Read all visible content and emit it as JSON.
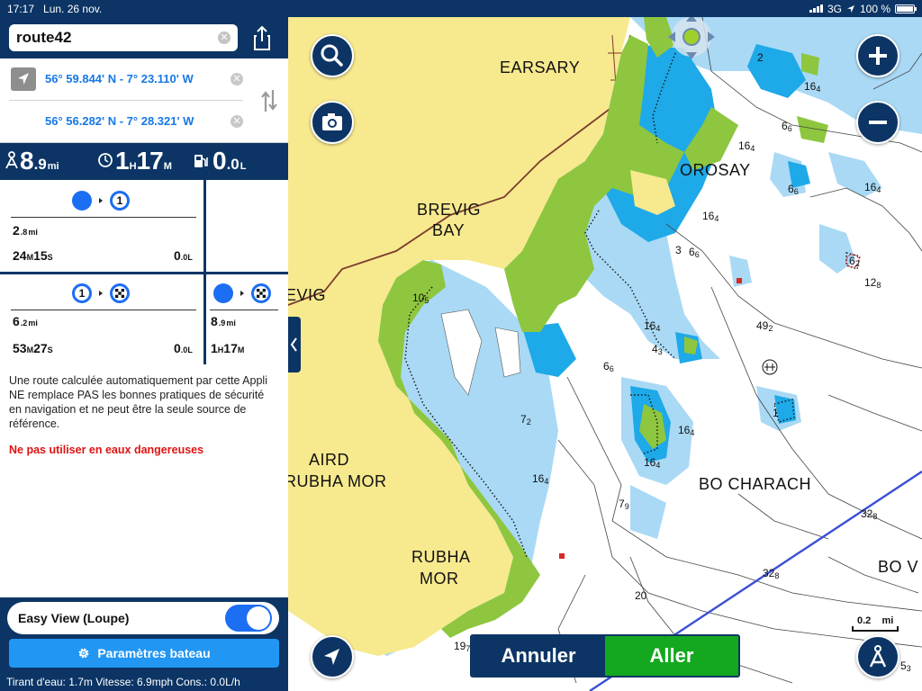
{
  "status_bar": {
    "time": "17:17",
    "date": "Lun. 26 nov.",
    "network": "3G",
    "battery": "100 %"
  },
  "route": {
    "name": "route42",
    "start_coord": "56° 59.844' N - 7° 23.110' W",
    "end_coord": "56° 56.282' N - 7° 28.321' W"
  },
  "summary": {
    "distance": {
      "value": "8",
      "decimal": ".9",
      "unit": "mi"
    },
    "duration": {
      "hours": "1",
      "h_unit": "H",
      "minutes": "17",
      "m_unit": "M"
    },
    "fuel": {
      "value": "0",
      "decimal": ".0",
      "unit": "L"
    }
  },
  "legs": [
    {
      "from": "",
      "to": "1",
      "dist": "2",
      "dist_dec": ".8",
      "dist_unit": "mi",
      "min": "24",
      "min_unit": "M",
      "sec": "15",
      "sec_unit": "S",
      "fuel": "0",
      "fuel_dec": ".0",
      "fuel_unit": "L"
    },
    {
      "from": "1",
      "to": "",
      "dist": "6",
      "dist_dec": ".2",
      "dist_unit": "mi",
      "min": "53",
      "min_unit": "M",
      "sec": "27",
      "sec_unit": "S",
      "fuel": "0",
      "fuel_dec": ".0",
      "fuel_unit": "L"
    },
    {
      "from": "",
      "to": "",
      "dist": "8",
      "dist_dec": ".9",
      "dist_unit": "mi",
      "hours": "1",
      "h_unit": "H",
      "min": "17",
      "min_unit": "M"
    }
  ],
  "info": {
    "disclaimer": "Une route calculée automatiquement par cette Appli NE remplace PAS les bonnes pratiques de sécurité en navigation et ne peut être la seule source de référence.",
    "warning": "Ne pas utiliser en eaux dangereuses"
  },
  "easy_view": {
    "label": "Easy View (Loupe)",
    "enabled": true
  },
  "settings_button": "Paramètres bateau",
  "footer": "Tirant d'eau: 1.7m Vitesse: 6.9mph Cons.: 0.0L/h",
  "map": {
    "labels": [
      {
        "id": "earsary",
        "text": "EARSARY"
      },
      {
        "id": "orosay",
        "text": "OROSAY"
      },
      {
        "id": "brevig-bay-1",
        "text": "BREVIG"
      },
      {
        "id": "brevig-bay-2",
        "text": "BAY"
      },
      {
        "id": "brevig",
        "text": "EVIG"
      },
      {
        "id": "aird-1",
        "text": "AIRD"
      },
      {
        "id": "aird-2",
        "text": "RUBHA MOR"
      },
      {
        "id": "rubha-1",
        "text": "RUBHA"
      },
      {
        "id": "rubha-2",
        "text": "MOR"
      },
      {
        "id": "bo-charach",
        "text": "BO CHARACH"
      },
      {
        "id": "bo-v",
        "text": "BO V"
      }
    ],
    "depths": [
      {
        "v": "2",
        "s": ""
      },
      {
        "v": "16",
        "s": "4"
      },
      {
        "v": "6",
        "s": "6"
      },
      {
        "v": "16",
        "s": "4"
      },
      {
        "v": "6",
        "s": "6"
      },
      {
        "v": "16",
        "s": "4"
      },
      {
        "v": "16",
        "s": "4"
      },
      {
        "v": "3",
        "s": ""
      },
      {
        "v": "6",
        "s": "6"
      },
      {
        "v": "6",
        "s": "2"
      },
      {
        "v": "12",
        "s": "8"
      },
      {
        "v": "10",
        "s": "5"
      },
      {
        "v": "49",
        "s": "2"
      },
      {
        "v": "16",
        "s": "4"
      },
      {
        "v": "4",
        "s": "3"
      },
      {
        "v": "6",
        "s": "6"
      },
      {
        "v": "7",
        "s": "2"
      },
      {
        "v": "16",
        "s": "4"
      },
      {
        "v": "1",
        "s": ""
      },
      {
        "v": "16",
        "s": "4"
      },
      {
        "v": "16",
        "s": "4"
      },
      {
        "v": "7",
        "s": "9"
      },
      {
        "v": "32",
        "s": "8"
      },
      {
        "v": "32",
        "s": "8"
      },
      {
        "v": "20",
        "s": ""
      },
      {
        "v": "19",
        "s": "7"
      },
      {
        "v": "5",
        "s": "3"
      }
    ],
    "scale": {
      "value": "0.2",
      "unit": "mi"
    }
  },
  "buttons": {
    "cancel": "Annuler",
    "go": "Aller"
  },
  "colors": {
    "panel": "#0c3565",
    "land": "#f7e98e",
    "foreshore": "#8ec63f",
    "shallow": "#1ea9e8",
    "medium": "#a9d9f5",
    "accent": "#1c6ef2",
    "go": "#13a81f",
    "warning": "#e01212"
  }
}
